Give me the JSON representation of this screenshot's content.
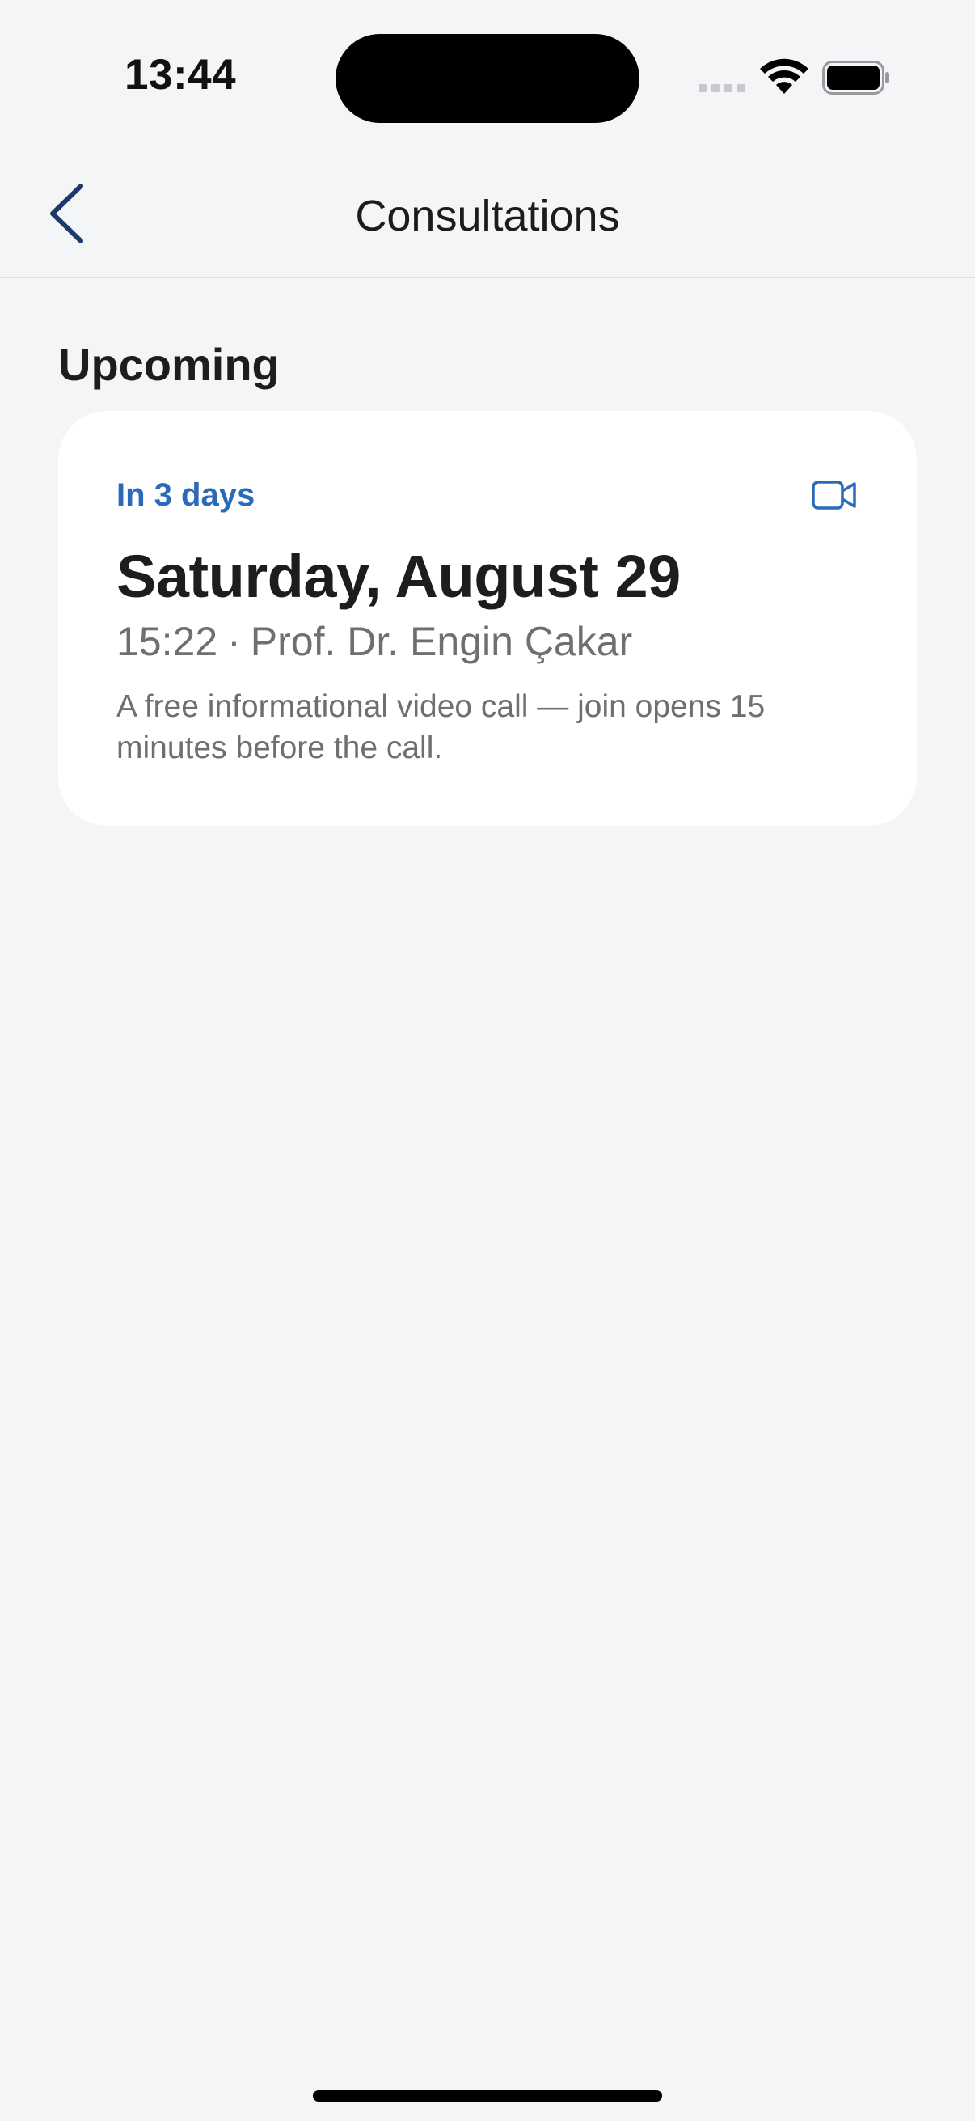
{
  "status_bar": {
    "time": "13:44"
  },
  "nav": {
    "title": "Consultations",
    "back_icon": "chevron-left-icon"
  },
  "section": {
    "title": "Upcoming"
  },
  "appointment": {
    "relative": "In 3 days",
    "date": "Saturday, August 29",
    "time": "15:22",
    "separator": "·",
    "doctor": "Prof. Dr. Engin Çakar",
    "description": "A free informational video call — join opens 15 minutes before the call.",
    "type_icon": "video-camera-icon"
  },
  "colors": {
    "accent": "#2a6ab8",
    "back_chevron": "#1b3a6b",
    "background": "#f4f5f7",
    "card": "#ffffff"
  }
}
